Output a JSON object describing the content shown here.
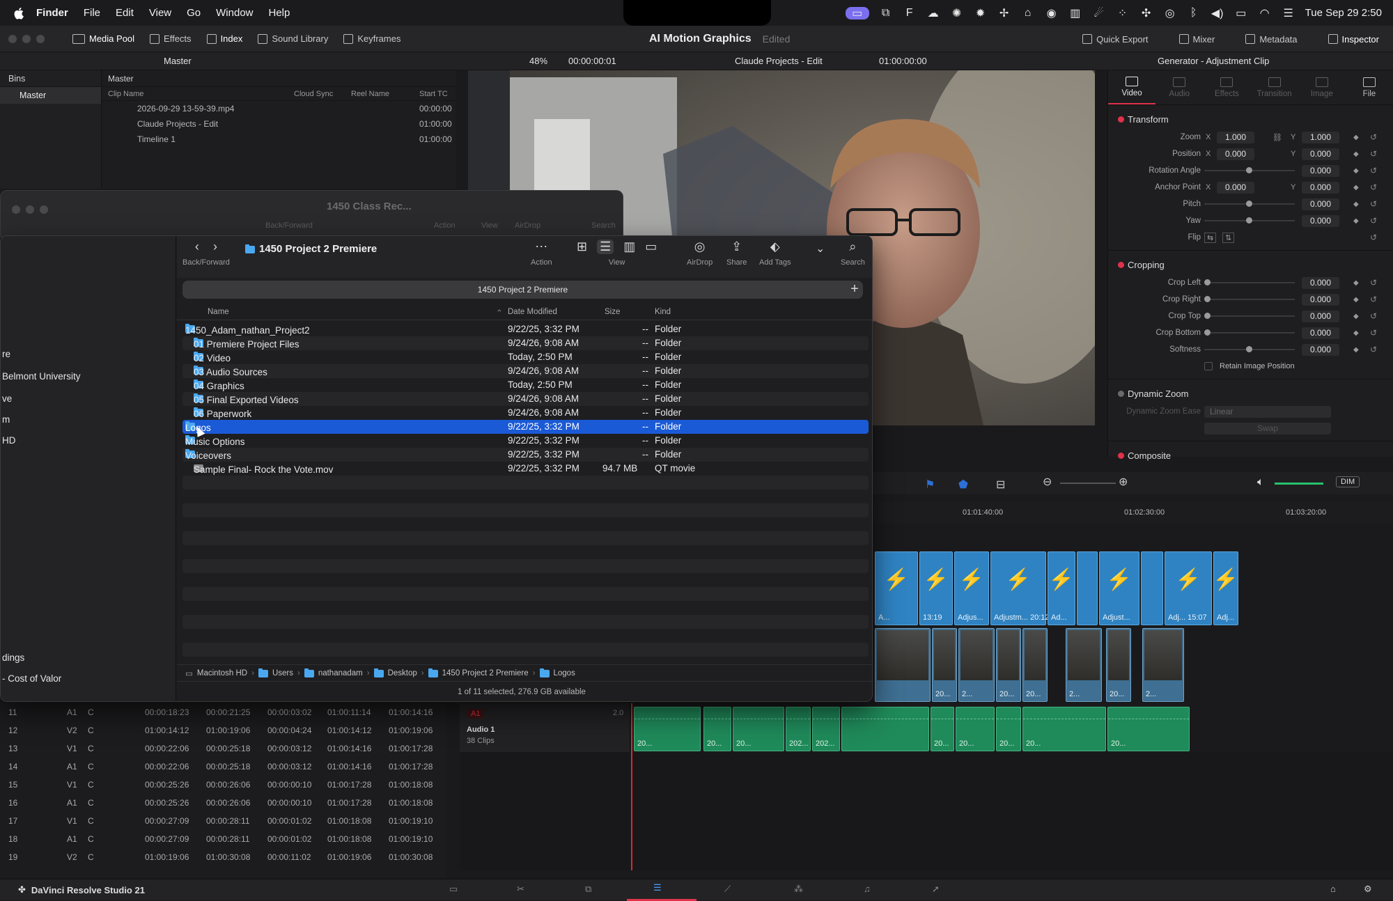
{
  "menubar": {
    "items": [
      "Finder",
      "File",
      "Edit",
      "View",
      "Go",
      "Window",
      "Help"
    ],
    "datetime": "Tue Sep 29  2:50"
  },
  "resolve_topbar": {
    "left_items": [
      "Media Pool",
      "Effects",
      "Index",
      "Sound Library",
      "Keyframes"
    ],
    "project_title": "AI Motion Graphics",
    "edited_label": "Edited",
    "right_items": [
      "Quick Export",
      "Mixer",
      "Metadata",
      "Inspector"
    ]
  },
  "bar2": {
    "master": "Master",
    "zoom": "48%",
    "timecode_left": "00:00:00:01",
    "timeline_name": "Claude Projects - Edit",
    "timecode_right": "01:00:00:00",
    "inspector_title": "Generator - Adjustment Clip"
  },
  "bins": {
    "header": "Bins",
    "selected": "Master"
  },
  "media_pool": {
    "header": "Master",
    "columns": [
      "Clip Name",
      "Cloud Sync",
      "Reel Name",
      "Start TC"
    ],
    "rows": [
      {
        "name": "2026-09-29 13-59-39.mp4",
        "tc": "00:00:00"
      },
      {
        "name": "Claude Projects - Edit",
        "tc": "01:00:00"
      },
      {
        "name": "Timeline 1",
        "tc": "01:00:00"
      }
    ]
  },
  "bg_finder": {
    "title": "1450 Class Rec...",
    "labels": [
      "Back/Forward",
      "Action",
      "View",
      "AirDrop",
      "Search"
    ]
  },
  "finder": {
    "title": "1450 Project 2 Premiere",
    "toolbar": {
      "back_forward": "Back/Forward",
      "action": "Action",
      "view": "View",
      "airdrop": "AirDrop",
      "share": "Share",
      "add_tags": "Add Tags",
      "search": "Search"
    },
    "path_tab": "1450 Project 2 Premiere",
    "columns": {
      "name": "Name",
      "date": "Date Modified",
      "size": "Size",
      "kind": "Kind"
    },
    "rows": [
      {
        "name": "1450_Adam_nathan_Project2",
        "date": "9/22/25, 3:32 PM",
        "size": "--",
        "kind": "Folder"
      },
      {
        "name": "01 Premiere Project Files",
        "date": "9/24/26, 9:08 AM",
        "size": "--",
        "kind": "Folder"
      },
      {
        "name": "02 Video",
        "date": "Today, 2:50 PM",
        "size": "--",
        "kind": "Folder"
      },
      {
        "name": "03 Audio Sources",
        "date": "9/24/26, 9:08 AM",
        "size": "--",
        "kind": "Folder"
      },
      {
        "name": "04 Graphics",
        "date": "Today, 2:50 PM",
        "size": "--",
        "kind": "Folder"
      },
      {
        "name": "05 Final Exported Videos",
        "date": "9/24/26, 9:08 AM",
        "size": "--",
        "kind": "Folder"
      },
      {
        "name": "06 Paperwork",
        "date": "9/24/26, 9:08 AM",
        "size": "--",
        "kind": "Folder"
      },
      {
        "name": "Logos",
        "date": "9/22/25, 3:32 PM",
        "size": "--",
        "kind": "Folder"
      },
      {
        "name": "Music Options",
        "date": "9/22/25, 3:32 PM",
        "size": "--",
        "kind": "Folder"
      },
      {
        "name": "Voiceovers",
        "date": "9/22/25, 3:32 PM",
        "size": "--",
        "kind": "Folder"
      },
      {
        "name": "Sample Final- Rock the Vote.mov",
        "date": "9/22/25, 3:32 PM",
        "size": "94.7 MB",
        "kind": "QT movie"
      }
    ],
    "path": [
      "Macintosh HD",
      "Users",
      "nathanadam",
      "Desktop",
      "1450 Project 2 Premiere",
      "Logos"
    ],
    "status": "1 of 11 selected, 276.9 GB available",
    "sidebar_fragments": [
      "re",
      "Belmont University",
      "ve",
      "m",
      "HD",
      "dings",
      "- Cost of Valor"
    ]
  },
  "inspector": {
    "tabs": [
      "Video",
      "Audio",
      "Effects",
      "Transition",
      "Image",
      "File"
    ],
    "transform": {
      "title": "Transform",
      "zoom_label": "Zoom",
      "zoom_x": "1.000",
      "zoom_y": "1.000",
      "position_label": "Position",
      "position_x": "0.000",
      "position_y": "0.000",
      "rotation_label": "Rotation Angle",
      "rotation": "0.000",
      "anchor_label": "Anchor Point",
      "anchor_x": "0.000",
      "anchor_y": "0.000",
      "pitch_label": "Pitch",
      "pitch": "0.000",
      "yaw_label": "Yaw",
      "yaw": "0.000",
      "flip_label": "Flip"
    },
    "cropping": {
      "title": "Cropping",
      "left_label": "Crop Left",
      "left": "0.000",
      "right_label": "Crop Right",
      "right": "0.000",
      "top_label": "Crop Top",
      "top": "0.000",
      "bottom_label": "Crop Bottom",
      "bottom": "0.000",
      "softness_label": "Softness",
      "softness": "0.000",
      "retain_label": "Retain Image Position"
    },
    "dynamic_zoom": {
      "title": "Dynamic Zoom",
      "ease_label": "Dynamic Zoom Ease",
      "ease_value": "Linear",
      "swap": "Swap"
    },
    "composite": {
      "title": "Composite"
    }
  },
  "timeline": {
    "ruler": [
      "01:01:40:00",
      "01:02:30:00",
      "01:03:20:00"
    ],
    "dim": "DIM",
    "adj_labels": [
      "A...",
      "13:19",
      "Adjus...",
      "Adjustm... 20:12",
      "Ad...",
      "Adjust...",
      "Adj... 15:07",
      "Adj..."
    ],
    "video_labels": [
      "20...",
      "2...",
      "20...",
      "20...",
      "2...",
      "20...",
      "2..."
    ],
    "audio_track": {
      "id": "A1",
      "name": "Audio 1",
      "count": "38 Clips",
      "level": "2.0"
    },
    "audio_labels": [
      "20...",
      "20...",
      "20...",
      "202...",
      "202...",
      "20...",
      "20...",
      "20...",
      "20...",
      "20..."
    ]
  },
  "index_rows": [
    {
      "n": "11",
      "t": "A1",
      "c": "C",
      "a": "00:00:18:23",
      "b": "00:00:21:25",
      "d": "00:00:03:02",
      "e": "01:00:11:14",
      "f": "01:00:14:16"
    },
    {
      "n": "12",
      "t": "V2",
      "c": "C",
      "a": "01:00:14:12",
      "b": "01:00:19:06",
      "d": "00:00:04:24",
      "e": "01:00:14:12",
      "f": "01:00:19:06"
    },
    {
      "n": "13",
      "t": "V1",
      "c": "C",
      "a": "00:00:22:06",
      "b": "00:00:25:18",
      "d": "00:00:03:12",
      "e": "01:00:14:16",
      "f": "01:00:17:28"
    },
    {
      "n": "14",
      "t": "A1",
      "c": "C",
      "a": "00:00:22:06",
      "b": "00:00:25:18",
      "d": "00:00:03:12",
      "e": "01:00:14:16",
      "f": "01:00:17:28"
    },
    {
      "n": "15",
      "t": "V1",
      "c": "C",
      "a": "00:00:25:26",
      "b": "00:00:26:06",
      "d": "00:00:00:10",
      "e": "01:00:17:28",
      "f": "01:00:18:08"
    },
    {
      "n": "16",
      "t": "A1",
      "c": "C",
      "a": "00:00:25:26",
      "b": "00:00:26:06",
      "d": "00:00:00:10",
      "e": "01:00:17:28",
      "f": "01:00:18:08"
    },
    {
      "n": "17",
      "t": "V1",
      "c": "C",
      "a": "00:00:27:09",
      "b": "00:00:28:11",
      "d": "00:00:01:02",
      "e": "01:00:18:08",
      "f": "01:00:19:10"
    },
    {
      "n": "18",
      "t": "A1",
      "c": "C",
      "a": "00:00:27:09",
      "b": "00:00:28:11",
      "d": "00:00:01:02",
      "e": "01:00:18:08",
      "f": "01:00:19:10"
    },
    {
      "n": "19",
      "t": "V2",
      "c": "C",
      "a": "01:00:19:06",
      "b": "01:00:30:08",
      "d": "00:00:11:02",
      "e": "01:00:19:06",
      "f": "01:00:30:08"
    }
  ],
  "app_name": "DaVinci Resolve Studio 21",
  "colors": {
    "accent_red": "#e0324a",
    "finder_selection": "#1a5ad6",
    "folder_blue": "#4aa8f0",
    "adj_clip": "#2f83c2",
    "audio_clip": "#1f8a5a"
  }
}
